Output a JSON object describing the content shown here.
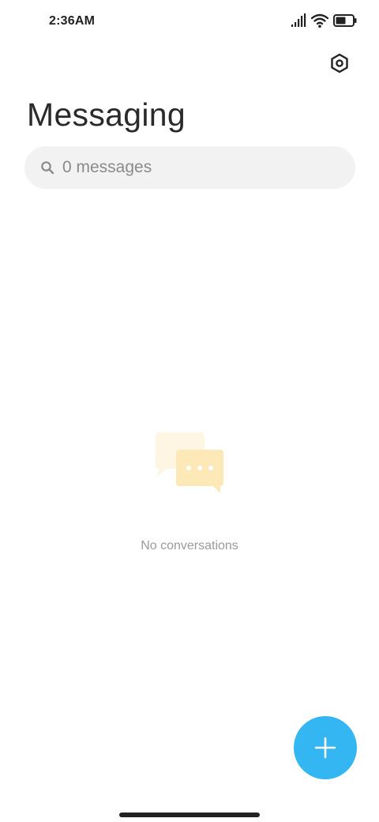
{
  "status_bar": {
    "time": "2:36AM",
    "icons": [
      "signal-icon",
      "wifi-icon",
      "battery-icon"
    ]
  },
  "header": {
    "title": "Messaging",
    "settings_icon": "settings-icon"
  },
  "search": {
    "icon": "search-icon",
    "placeholder": "0 messages"
  },
  "empty_state": {
    "illustration": "chat-bubbles-icon",
    "message": "No conversations"
  },
  "fab": {
    "icon": "plus-icon"
  },
  "colors": {
    "accent": "#33b6f2",
    "illustration": "#fde9b8"
  }
}
